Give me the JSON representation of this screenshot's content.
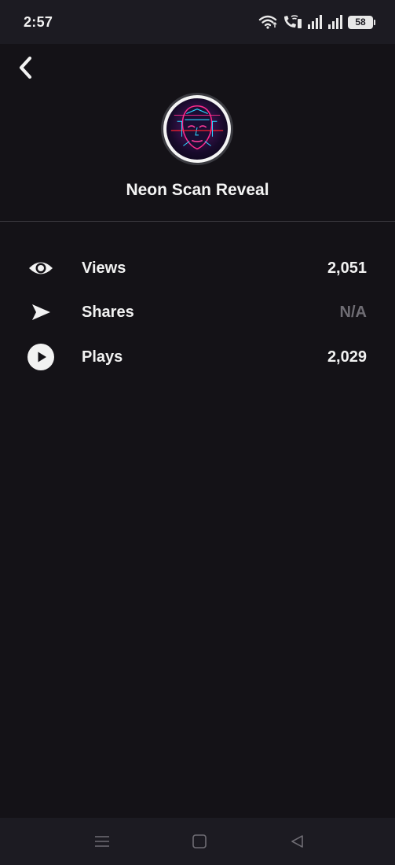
{
  "status_bar": {
    "time": "2:57",
    "battery_level": "58",
    "icons": [
      "wifi-icon",
      "wifi-calling-icon",
      "signal-icon",
      "signal-icon",
      "battery-icon"
    ]
  },
  "header": {
    "back_icon": "chevron-left-icon"
  },
  "lens": {
    "name": "Neon Scan Reveal",
    "thumbnail": "neon-face-scan-image"
  },
  "stats": [
    {
      "icon": "eye-icon",
      "label": "Views",
      "value": "2,051"
    },
    {
      "icon": "send-arrow-icon",
      "label": "Shares",
      "value": "N/A"
    },
    {
      "icon": "play-circle-icon",
      "label": "Plays",
      "value": "2,029"
    }
  ],
  "nav": {
    "icons": [
      "menu-icon",
      "home-square-icon",
      "back-triangle-icon"
    ]
  },
  "colors": {
    "background": "#141217",
    "bars": "#1c1b22",
    "text": "#f2f2f2",
    "muted": "#6f6d74",
    "divider": "#38363d"
  }
}
